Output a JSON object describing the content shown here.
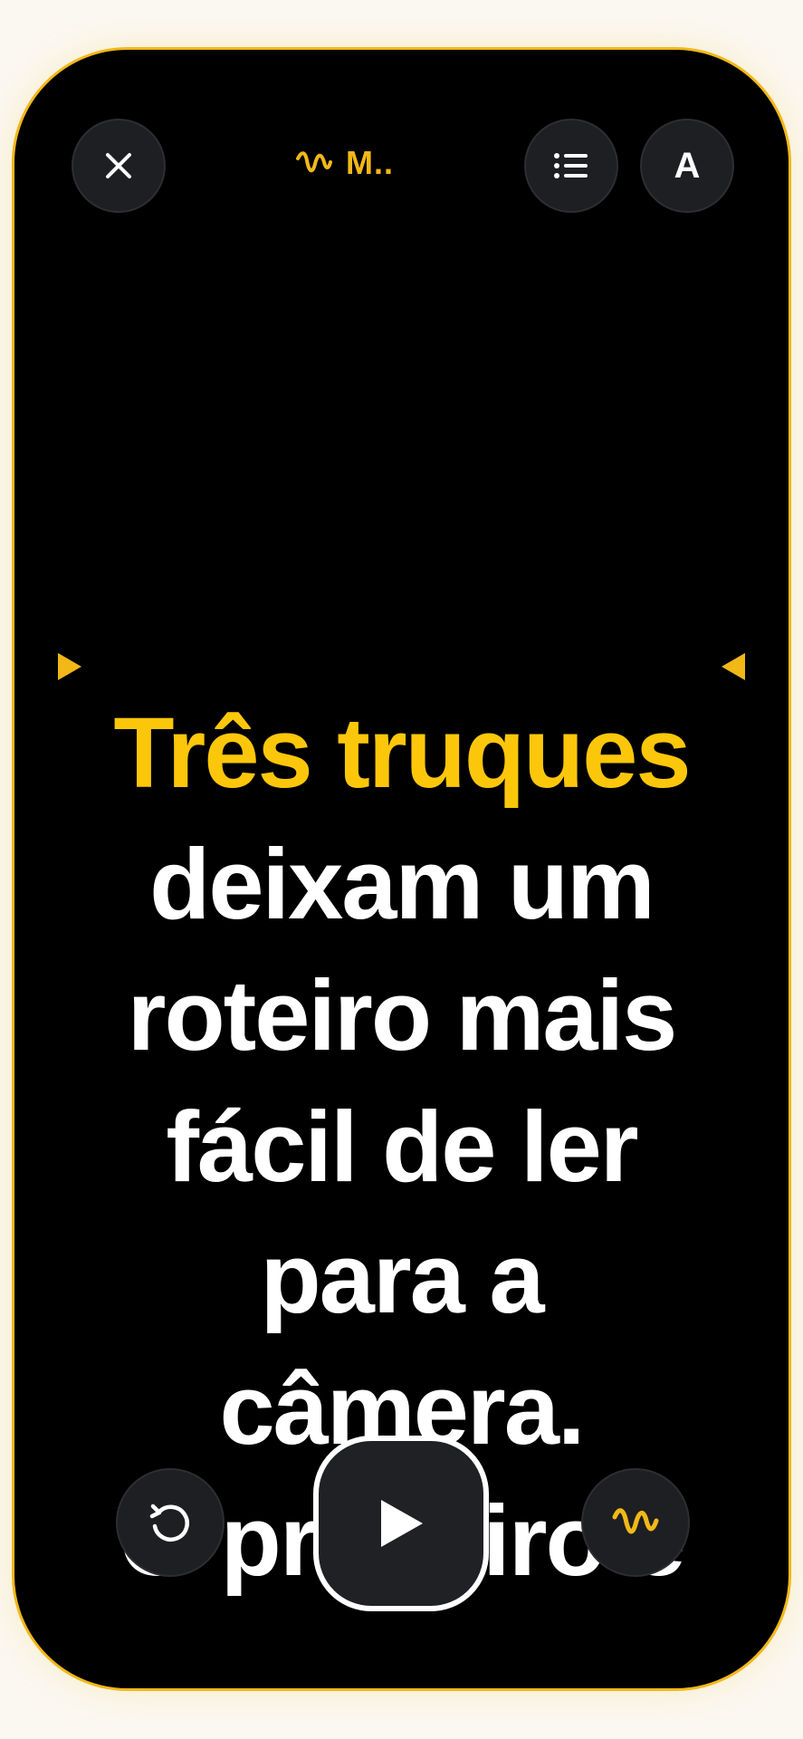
{
  "header": {
    "title": "M..",
    "title_icon": "waveform-icon",
    "close_icon": "close-icon",
    "list_icon": "list-icon",
    "font_label": "A"
  },
  "script": {
    "lines": [
      {
        "text": "Três truques",
        "highlighted": true
      },
      {
        "text": "deixam um",
        "highlighted": false
      },
      {
        "text": "roteiro mais",
        "highlighted": false
      },
      {
        "text": "fácil de ler",
        "highlighted": false
      },
      {
        "text": "para a",
        "highlighted": false
      },
      {
        "text": "câmera.",
        "highlighted": false
      },
      {
        "text": "O primeiro é",
        "highlighted": false
      }
    ]
  },
  "controls": {
    "replay_icon": "replay-icon",
    "play_icon": "play-icon",
    "wave_icon": "waveform-icon"
  },
  "colors": {
    "accent": "#f2b818",
    "highlight_text": "#fcc70a",
    "background": "#000000",
    "button_bg": "#1e1f22"
  }
}
